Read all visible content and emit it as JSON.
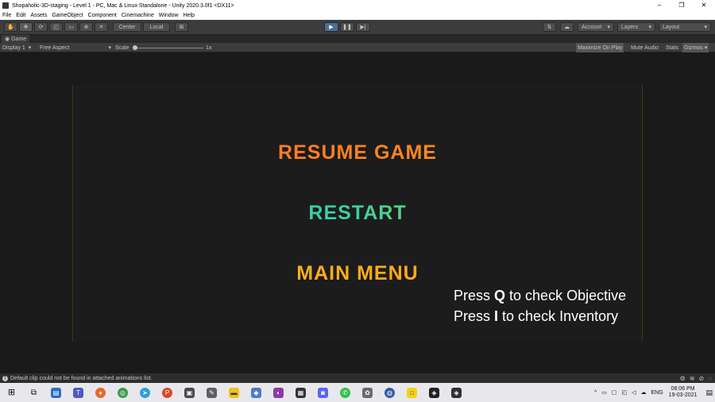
{
  "window": {
    "title": "Shopaholic-3D-staging - Level 1 - PC, Mac & Linux Standalone - Unity 2020.3.0f1 <DX11>",
    "controls": [
      "–",
      "❐",
      "✕"
    ]
  },
  "menu": [
    "File",
    "Edit",
    "Assets",
    "GameObject",
    "Component",
    "Cinemachine",
    "Window",
    "Help"
  ],
  "toolbar": {
    "pivot_center": "Center",
    "pivot_local": "Local",
    "account": "Account",
    "layers": "Layers",
    "layout": "Layout"
  },
  "game_tab": {
    "label": "Game"
  },
  "game_toolbar": {
    "display": "Display 1",
    "aspect": "Free Aspect",
    "scale_label": "Scale",
    "scale_value": "1x",
    "maximize": "Maximize On Play",
    "mute": "Mute Audio",
    "stats": "Stats",
    "gizmos": "Gizmos"
  },
  "pause_menu": {
    "resume": "RESUME GAME",
    "restart": "RESTART",
    "main_menu": "MAIN MENU"
  },
  "hints": {
    "line1_pre": "Press ",
    "line1_key": "Q",
    "line1_post": " to check Objective",
    "line2_pre": "Press ",
    "line2_key": "I",
    "line2_post": " to check Inventory"
  },
  "status": {
    "message": "Default clip could not be found in attached animations list."
  },
  "taskbar": {
    "language": "ENG",
    "time": "08:06 PM",
    "date": "19-03-2021"
  }
}
